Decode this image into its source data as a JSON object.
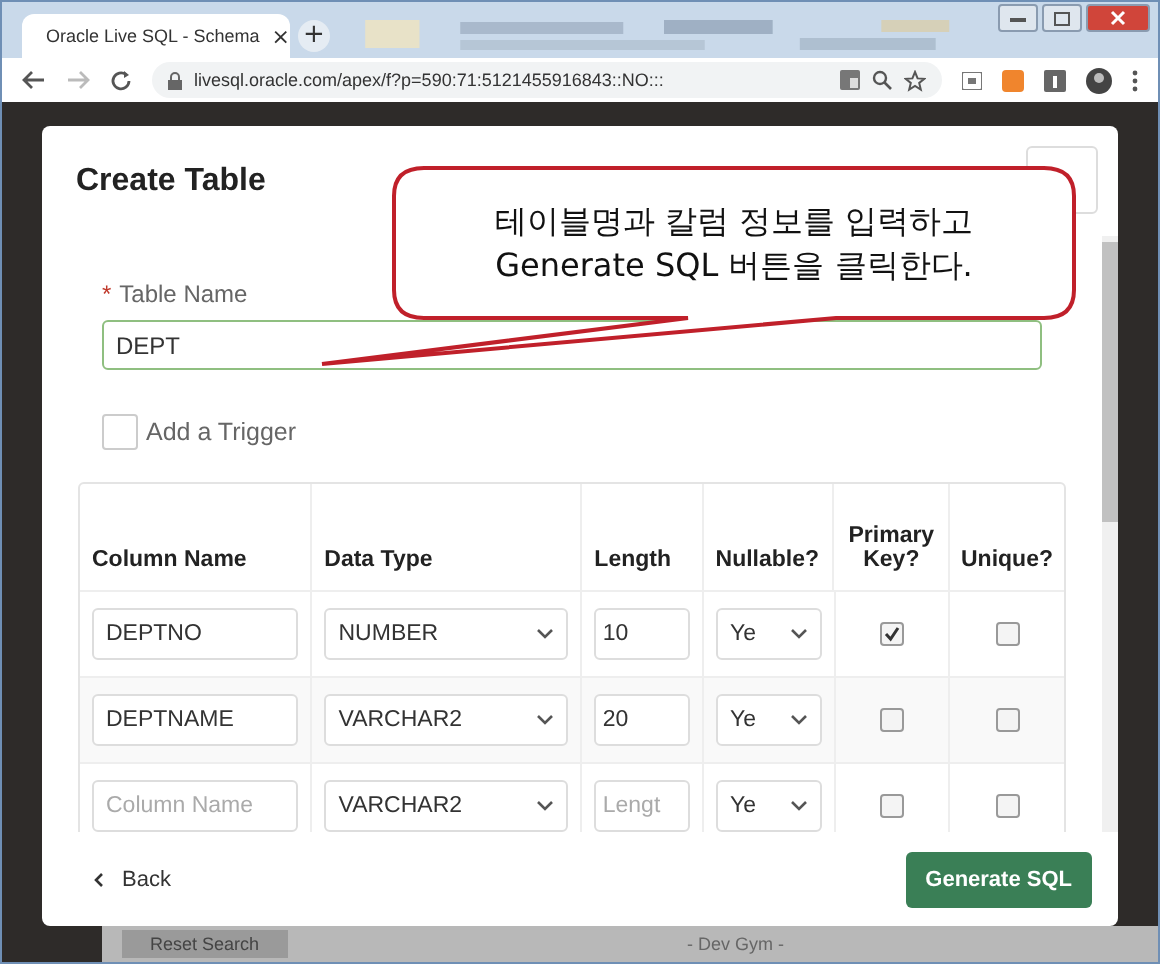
{
  "browser": {
    "tab_title": "Oracle Live SQL - Schema",
    "tab_close": "×",
    "new_tab": "+",
    "address": "livesql.oracle.com/apex/f?p=590:71:5121455916843::NO:::"
  },
  "dialog": {
    "title": "Create Table",
    "required_mark": "*",
    "table_name_label": "Table Name",
    "table_name_value": "DEPT",
    "add_trigger": {
      "label": "Add a Trigger",
      "checked": false
    }
  },
  "columns": [
    "Column Name",
    "Data Type",
    "Length",
    "Nullable?",
    "Primary Key?",
    "Unique?"
  ],
  "rows": [
    {
      "column_name": {
        "value": "DEPTNO"
      },
      "data_type": "NUMBER",
      "length": {
        "value": "10"
      },
      "nullable": "Ye",
      "primary_key": true,
      "unique": false
    },
    {
      "column_name": {
        "value": "DEPTNAME"
      },
      "data_type": "VARCHAR2",
      "length": {
        "value": "20"
      },
      "nullable": "Ye",
      "primary_key": false,
      "unique": false
    },
    {
      "column_name": {
        "placeholder": "Column Name"
      },
      "data_type": "VARCHAR2",
      "length": {
        "placeholder": "Lengt"
      },
      "nullable": "Ye",
      "primary_key": false,
      "unique": false
    }
  ],
  "footer": {
    "back": "Back",
    "generate": "Generate SQL"
  },
  "callout": {
    "lines": [
      "테이블명과 칼럼 정보를 입력하고",
      "Generate SQL 버튼을 클릭한다."
    ]
  },
  "background": {
    "reset_search": "Reset Search",
    "dev_gym": "- Dev Gym -"
  }
}
